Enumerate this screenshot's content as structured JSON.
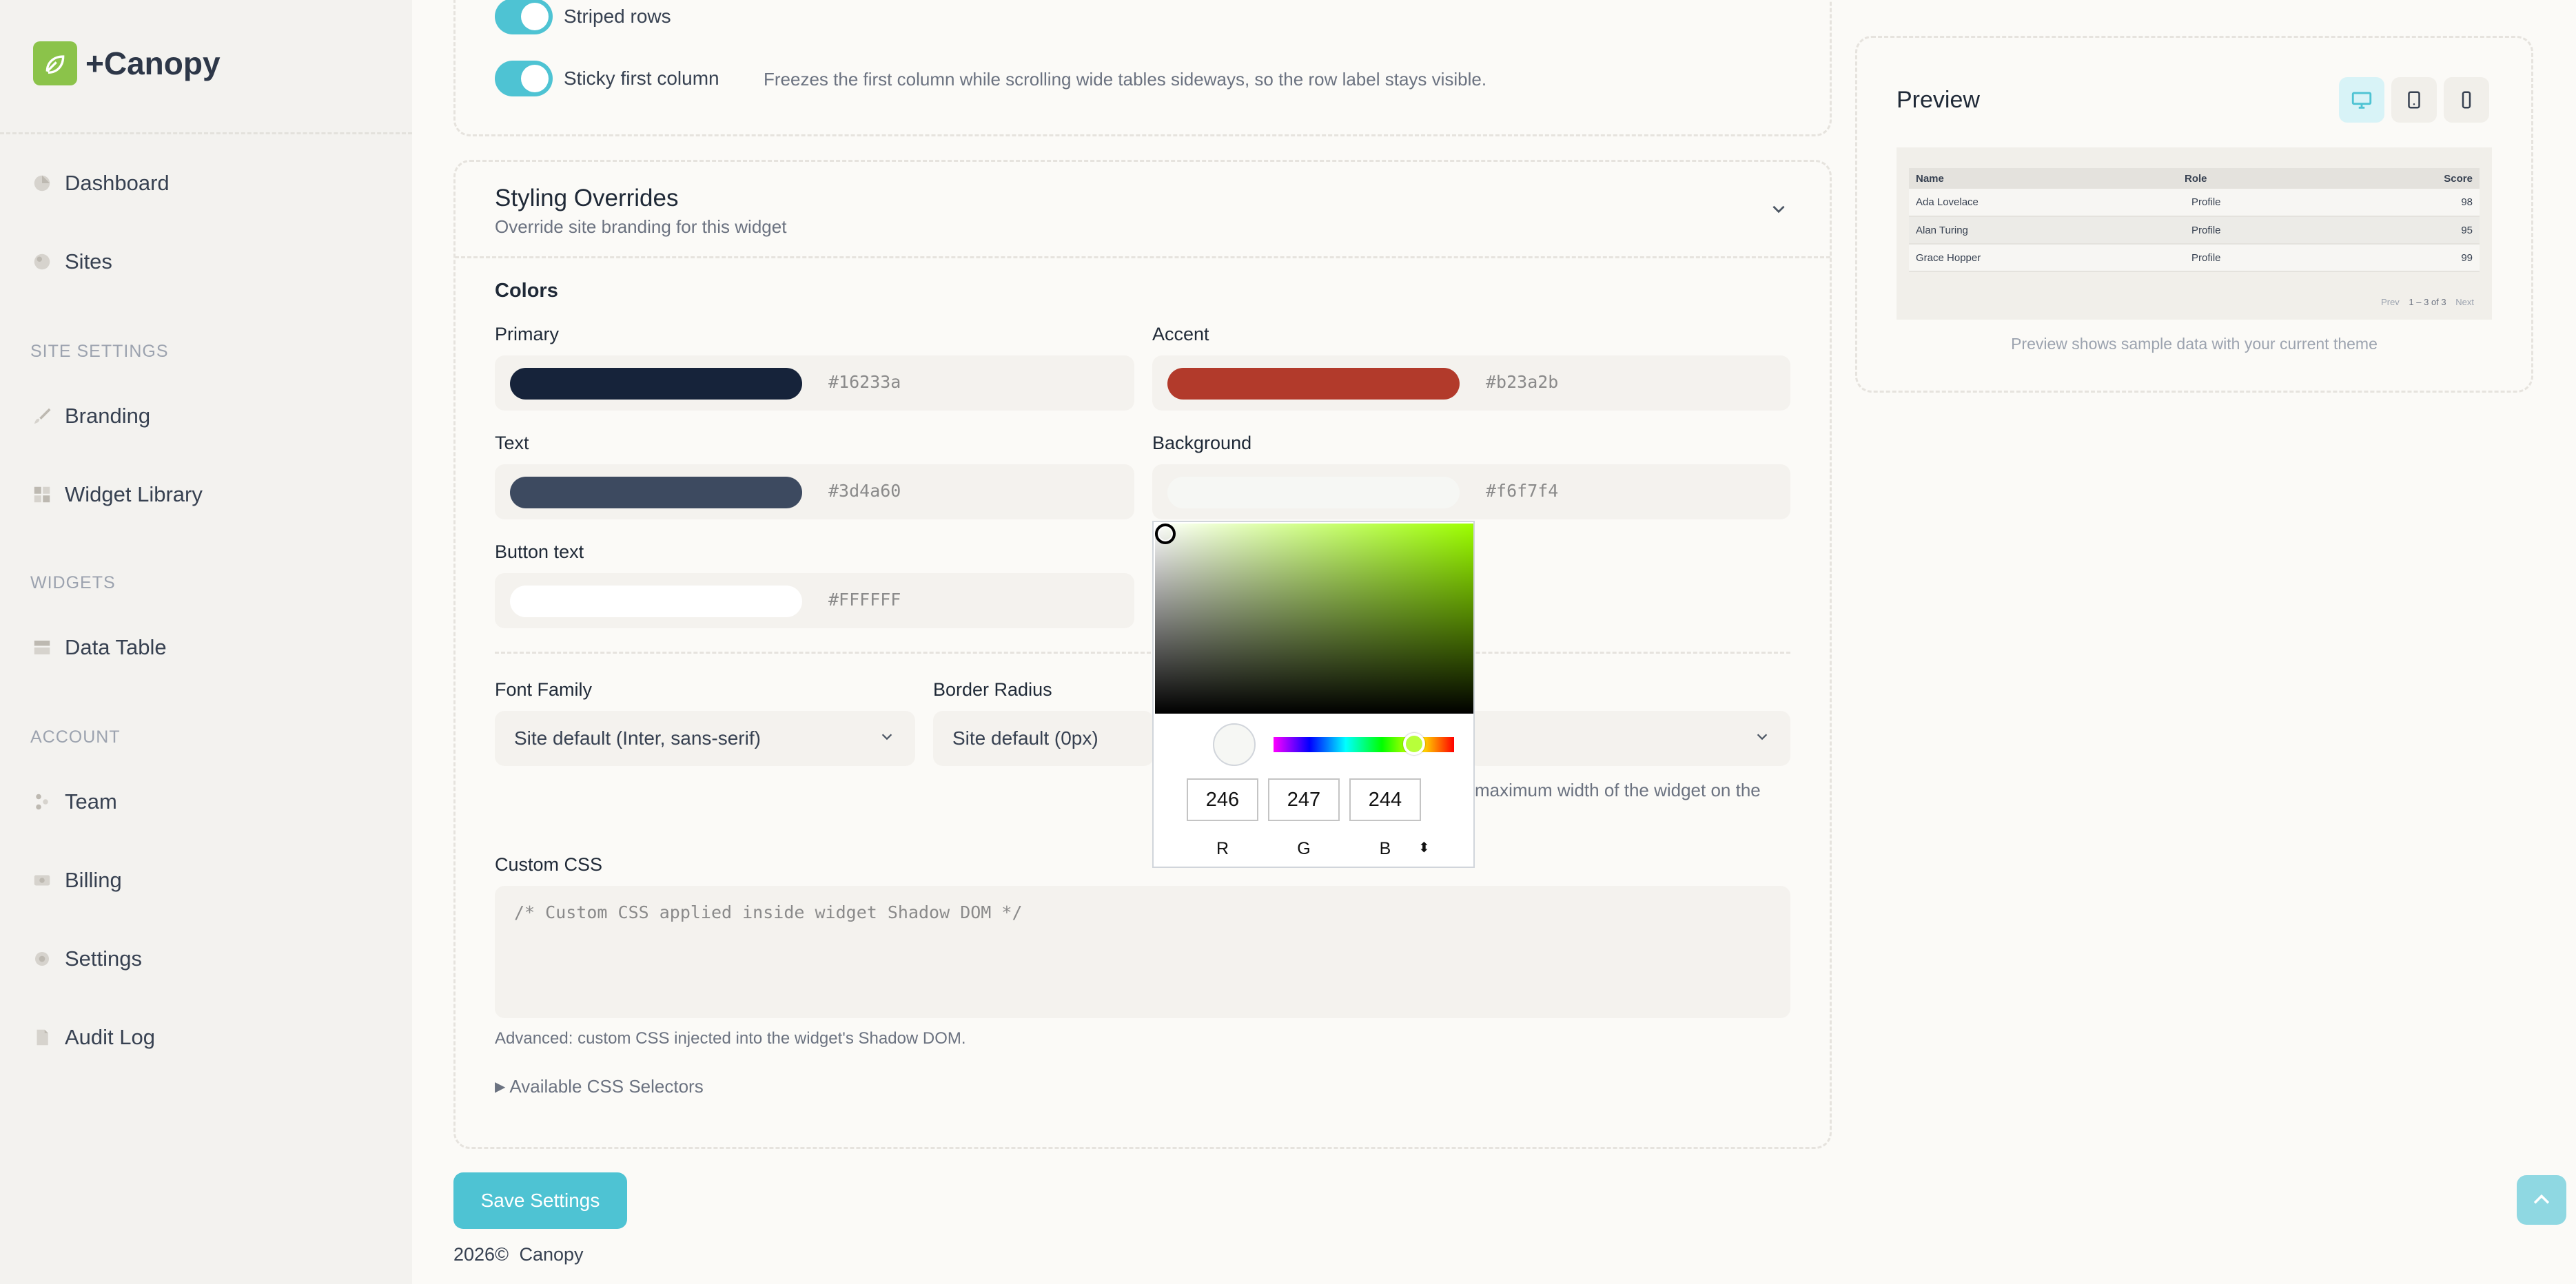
{
  "app": {
    "name": "+Canopy"
  },
  "sidebar": {
    "items": [
      {
        "label": "Dashboard"
      },
      {
        "label": "Sites"
      },
      {
        "label": "Branding"
      },
      {
        "label": "Widget Library"
      },
      {
        "label": "Data Table"
      },
      {
        "label": "Team"
      },
      {
        "label": "Billing"
      },
      {
        "label": "Settings"
      },
      {
        "label": "Audit Log"
      }
    ],
    "sections": {
      "site_settings": "SITE SETTINGS",
      "widgets": "WIDGETS",
      "account": "ACCOUNT"
    }
  },
  "display": {
    "striped_rows": "Striped rows",
    "sticky_first_column": "Sticky first column",
    "sticky_hint": "Freezes the first column while scrolling wide tables sideways, so the row label stays visible."
  },
  "styling": {
    "title": "Styling Overrides",
    "subtitle": "Override site branding for this widget",
    "colors_heading": "Colors",
    "colors": {
      "primary": {
        "label": "Primary",
        "hex": "#16233a"
      },
      "accent": {
        "label": "Accent",
        "hex": "#b23a2b"
      },
      "text": {
        "label": "Text",
        "hex": "#3d4a60"
      },
      "background": {
        "label": "Background",
        "hex": "#f6f7f4"
      },
      "button_text": {
        "label": "Button text",
        "hex": "#FFFFFF"
      }
    },
    "font_family": {
      "label": "Font Family",
      "value": "Site default (Inter, sans-serif)"
    },
    "border_radius": {
      "label": "Border Radius",
      "value": "Site default (0px)"
    },
    "max_width_hint": "maximum width of the widget on the",
    "custom_css": {
      "label": "Custom CSS",
      "placeholder": "/* Custom CSS applied inside widget Shadow DOM */",
      "hint": "Advanced: custom CSS injected into the widget's Shadow DOM."
    },
    "available_selectors": "Available CSS Selectors"
  },
  "picker": {
    "r": "246",
    "g": "247",
    "b": "244",
    "r_label": "R",
    "g_label": "G",
    "b_label": "B",
    "swap_symbol": "⬍"
  },
  "actions": {
    "save": "Save Settings"
  },
  "footer": {
    "year": "2026©",
    "brand": "Canopy"
  },
  "preview": {
    "title": "Preview",
    "headers": [
      "Name",
      "Role",
      "Score"
    ],
    "rows": [
      {
        "name": "Ada Lovelace",
        "role": "Profile",
        "score": "98"
      },
      {
        "name": "Alan Turing",
        "role": "Profile",
        "score": "95"
      },
      {
        "name": "Grace Hopper",
        "role": "Profile",
        "score": "99"
      }
    ],
    "pager_prev": "Prev",
    "pager_info": "1 – 3 of 3",
    "pager_next": "Next",
    "note": "Preview shows sample data with your current theme"
  }
}
